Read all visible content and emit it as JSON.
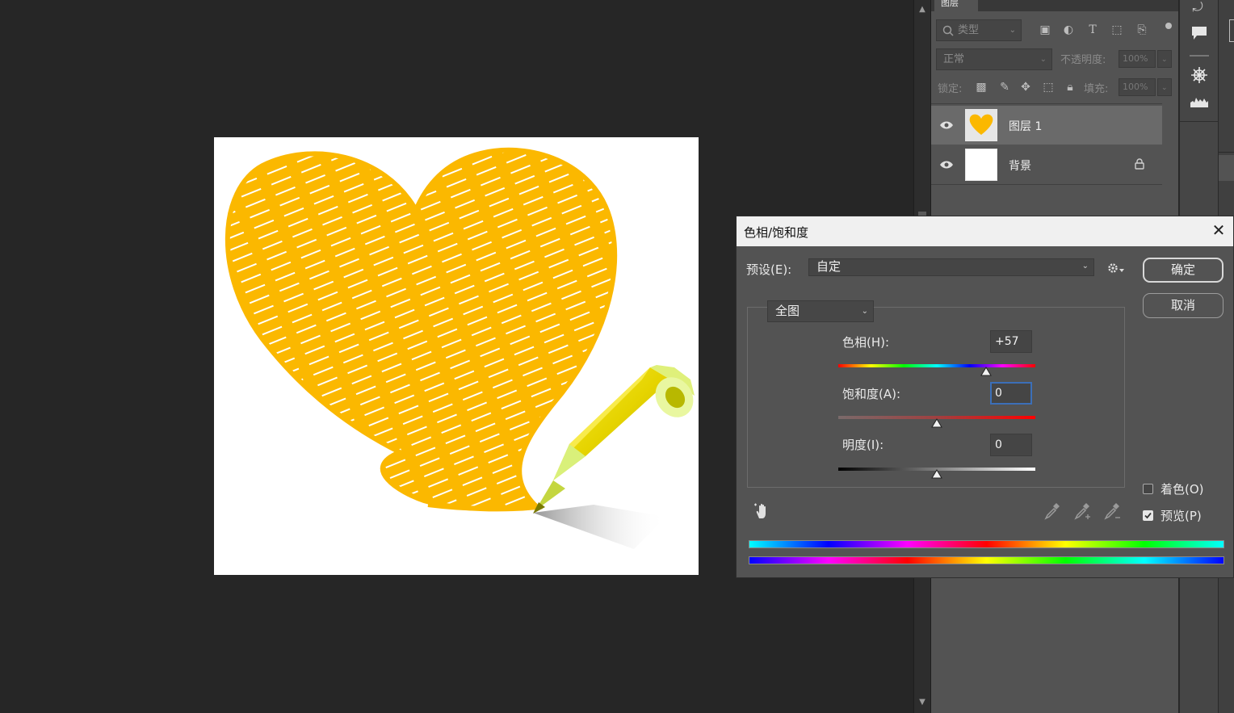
{
  "layers_panel": {
    "tab_label": "图层",
    "filter_kind": "类型",
    "blend_mode": "正常",
    "opacity_label": "不透明度:",
    "opacity_value": "100%",
    "lock_label": "锁定:",
    "fill_label": "填充:",
    "fill_value": "100%",
    "layers": [
      {
        "name": "图层 1",
        "selected": true,
        "locked": false
      },
      {
        "name": "背景",
        "selected": false,
        "locked": true
      }
    ]
  },
  "dialog": {
    "title": "色相/饱和度",
    "preset_label": "预设(E):",
    "preset_value": "自定",
    "channel_value": "全图",
    "ok_label": "确定",
    "cancel_label": "取消",
    "hue_label": "色相(H):",
    "hue_value": "+57",
    "saturation_label": "饱和度(A):",
    "saturation_value": "0",
    "lightness_label": "明度(I):",
    "lightness_value": "0",
    "colorize_label": "着色(O)",
    "colorize_checked": false,
    "preview_label": "预览(P)",
    "preview_checked": true
  },
  "colors": {
    "heart": "#fbb800",
    "pencil": "#e6d400",
    "dialog_bg": "#535353",
    "focus_border": "#3c6fb8"
  },
  "icons": [
    "search-icon",
    "image-filter-icon",
    "adjustment-filter-icon",
    "type-filter-icon",
    "shape-filter-icon",
    "smart-object-filter-icon",
    "eye-icon",
    "lock-icon",
    "gear-icon",
    "hand-adjust-icon",
    "eyedropper-icon",
    "eyedropper-plus-icon",
    "eyedropper-minus-icon",
    "comment-icon",
    "ship-wheel-icon",
    "histogram-icon",
    "close-icon"
  ]
}
